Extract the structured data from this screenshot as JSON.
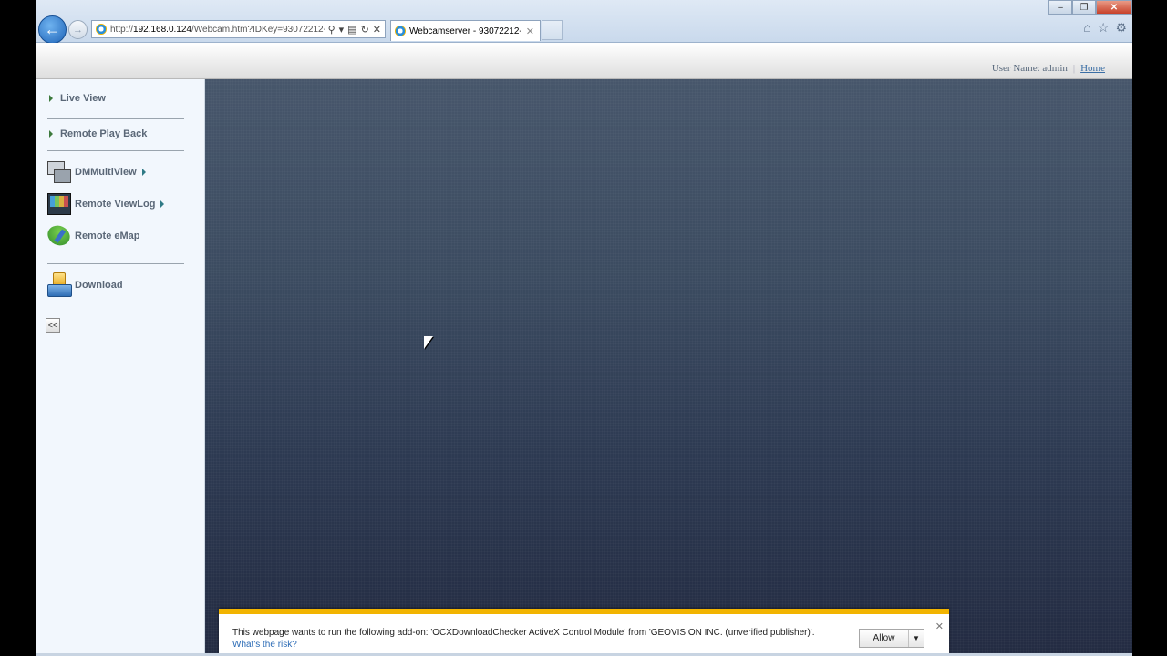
{
  "browser": {
    "url_prefix": "http://",
    "url_host": "192.168.0.124",
    "url_path": "/Webcam.htm?IDKey=93072212-",
    "tab_title": "Webcamserver - 93072212-...",
    "icons": [
      "back-arrow-icon",
      "forward-arrow-icon",
      "search-icon",
      "refresh-icon",
      "home-icon",
      "star-icon",
      "gear-icon"
    ]
  },
  "header": {
    "user_label": "User Name: admin",
    "separator": "|",
    "home_link": "Home"
  },
  "sidebar": {
    "live_view": "Live View",
    "remote_playback": "Remote Play Back",
    "dm_multiview": "DMMultiView",
    "remote_viewlog": "Remote ViewLog",
    "remote_emap": "Remote eMap",
    "download": "Download",
    "collapse": "<<"
  },
  "notification": {
    "message": "This webpage wants to run the following add-on: 'OCXDownloadChecker ActiveX Control Module' from 'GEOVISION INC. (unverified publisher)'.",
    "risk_link": "What's the risk?",
    "allow_label": "Allow",
    "accent_color": "#f2b400"
  }
}
